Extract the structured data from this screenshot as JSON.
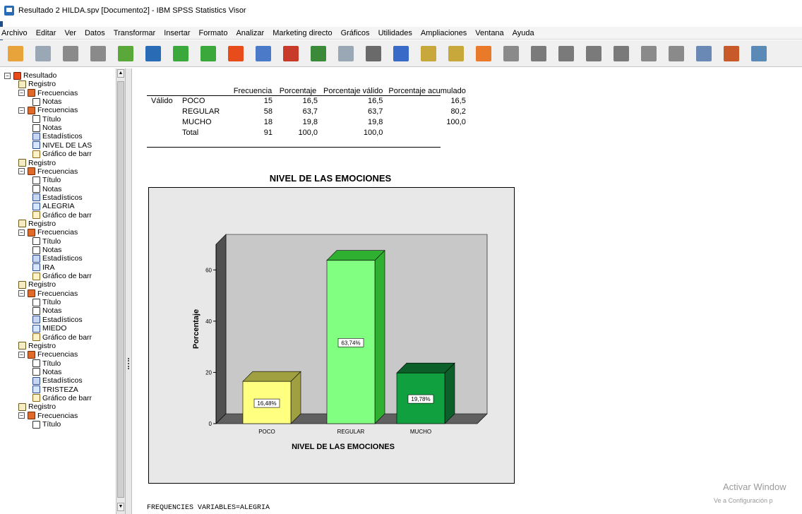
{
  "window": {
    "title": "Resultado 2 HILDA.spv [Documento2] - IBM SPSS Statistics Visor"
  },
  "menu": [
    "Archivo",
    "Editar",
    "Ver",
    "Datos",
    "Transformar",
    "Insertar",
    "Formato",
    "Analizar",
    "Marketing directo",
    "Gráficos",
    "Utilidades",
    "Ampliaciones",
    "Ventana",
    "Ayuda"
  ],
  "toolbar_icons": [
    {
      "name": "open-folder-icon",
      "color": "#e8a33a"
    },
    {
      "name": "save-icon",
      "color": "#9aa7b5"
    },
    {
      "name": "print-icon",
      "color": "#8a8a8a"
    },
    {
      "name": "print-preview-icon",
      "color": "#8a8a8a"
    },
    {
      "name": "export-icon",
      "color": "#5aa83a"
    },
    {
      "name": "recall-dialog-icon",
      "color": "#2a6bb5"
    },
    {
      "name": "undo-icon",
      "color": "#3aa83a"
    },
    {
      "name": "redo-icon",
      "color": "#3aa83a"
    },
    {
      "name": "goto-data-icon",
      "color": "#e84c1a"
    },
    {
      "name": "goto-case-icon",
      "color": "#4a7ac8"
    },
    {
      "name": "variables-icon",
      "color": "#c83a2a"
    },
    {
      "name": "use-sets-icon",
      "color": "#3a8a3a"
    },
    {
      "name": "show-all-icon",
      "color": "#9aa7b5"
    },
    {
      "name": "pie-icon",
      "color": "#6a6a6a"
    },
    {
      "name": "insert-output-icon",
      "color": "#3a6ac8"
    },
    {
      "name": "designate-window-icon",
      "color": "#c8a83a"
    },
    {
      "name": "edit-icon",
      "color": "#c8a83a"
    },
    {
      "name": "script-icon",
      "color": "#e87a2a"
    },
    {
      "name": "stop-icon",
      "color": "#8a8a8a"
    },
    {
      "name": "back-arrow-icon",
      "color": "#7a7a7a"
    },
    {
      "name": "forward-arrow-icon",
      "color": "#7a7a7a"
    },
    {
      "name": "expand-icon",
      "color": "#7a7a7a"
    },
    {
      "name": "collapse-icon",
      "color": "#7a7a7a"
    },
    {
      "name": "show-icon",
      "color": "#8a8a8a"
    },
    {
      "name": "hide-icon",
      "color": "#8a8a8a"
    },
    {
      "name": "insert-heading-icon",
      "color": "#6a8ab5"
    },
    {
      "name": "insert-title-icon",
      "color": "#c85a2a"
    },
    {
      "name": "insert-text-icon",
      "color": "#5a8ab5"
    }
  ],
  "outline": [
    {
      "level": 0,
      "type": "resultado",
      "label": "Resultado"
    },
    {
      "level": 1,
      "type": "registro",
      "label": "Registro"
    },
    {
      "level": 1,
      "type": "frec",
      "label": "Frecuencias"
    },
    {
      "level": 2,
      "type": "notas",
      "label": "Notas"
    },
    {
      "level": 1,
      "type": "frec",
      "label": "Frecuencias"
    },
    {
      "level": 2,
      "type": "titulo",
      "label": "Título"
    },
    {
      "level": 2,
      "type": "notas",
      "label": "Notas"
    },
    {
      "level": 2,
      "type": "estad",
      "label": "Estadísticos"
    },
    {
      "level": 2,
      "type": "tabla",
      "label": "NIVEL DE LAS"
    },
    {
      "level": 2,
      "type": "grafico",
      "label": "Gráfico de barr"
    },
    {
      "level": 1,
      "type": "registro",
      "label": "Registro"
    },
    {
      "level": 1,
      "type": "frec",
      "label": "Frecuencias"
    },
    {
      "level": 2,
      "type": "titulo",
      "label": "Título"
    },
    {
      "level": 2,
      "type": "notas",
      "label": "Notas"
    },
    {
      "level": 2,
      "type": "estad",
      "label": "Estadísticos"
    },
    {
      "level": 2,
      "type": "tabla",
      "label": "ALEGRIA"
    },
    {
      "level": 2,
      "type": "grafico",
      "label": "Gráfico de barr"
    },
    {
      "level": 1,
      "type": "registro",
      "label": "Registro"
    },
    {
      "level": 1,
      "type": "frec",
      "label": "Frecuencias"
    },
    {
      "level": 2,
      "type": "titulo",
      "label": "Título"
    },
    {
      "level": 2,
      "type": "notas",
      "label": "Notas"
    },
    {
      "level": 2,
      "type": "estad",
      "label": "Estadísticos"
    },
    {
      "level": 2,
      "type": "tabla",
      "label": "IRA"
    },
    {
      "level": 2,
      "type": "grafico",
      "label": "Gráfico de barr"
    },
    {
      "level": 1,
      "type": "registro",
      "label": "Registro"
    },
    {
      "level": 1,
      "type": "frec",
      "label": "Frecuencias"
    },
    {
      "level": 2,
      "type": "titulo",
      "label": "Título"
    },
    {
      "level": 2,
      "type": "notas",
      "label": "Notas"
    },
    {
      "level": 2,
      "type": "estad",
      "label": "Estadísticos"
    },
    {
      "level": 2,
      "type": "tabla",
      "label": "MIEDO"
    },
    {
      "level": 2,
      "type": "grafico",
      "label": "Gráfico de barr"
    },
    {
      "level": 1,
      "type": "registro",
      "label": "Registro"
    },
    {
      "level": 1,
      "type": "frec",
      "label": "Frecuencias"
    },
    {
      "level": 2,
      "type": "titulo",
      "label": "Título"
    },
    {
      "level": 2,
      "type": "notas",
      "label": "Notas"
    },
    {
      "level": 2,
      "type": "estad",
      "label": "Estadísticos"
    },
    {
      "level": 2,
      "type": "tabla",
      "label": "TRISTEZA"
    },
    {
      "level": 2,
      "type": "grafico",
      "label": "Gráfico de barr"
    },
    {
      "level": 1,
      "type": "registro",
      "label": "Registro"
    },
    {
      "level": 1,
      "type": "frec",
      "label": "Frecuencias"
    },
    {
      "level": 2,
      "type": "titulo",
      "label": "Título"
    }
  ],
  "freq_table": {
    "headers": [
      "Frecuencia",
      "Porcentaje",
      "Porcentaje válido",
      "Porcentaje acumulado"
    ],
    "group_label": "Válido",
    "rows": [
      {
        "label": "POCO",
        "frecuencia": "15",
        "porcentaje": "16,5",
        "valido": "16,5",
        "acumulado": "16,5"
      },
      {
        "label": "REGULAR",
        "frecuencia": "58",
        "porcentaje": "63,7",
        "valido": "63,7",
        "acumulado": "80,2"
      },
      {
        "label": "MUCHO",
        "frecuencia": "18",
        "porcentaje": "19,8",
        "valido": "19,8",
        "acumulado": "100,0"
      },
      {
        "label": "Total",
        "frecuencia": "91",
        "porcentaje": "100,0",
        "valido": "100,0",
        "acumulado": ""
      }
    ]
  },
  "chart_heading": "NIVEL DE LAS EMOCIONES",
  "chart_data": {
    "type": "bar",
    "title": "NIVEL DE LAS EMOCIONES",
    "xlabel": "NIVEL DE LAS EMOCIONES",
    "ylabel": "Porcentaje",
    "categories": [
      "POCO",
      "REGULAR",
      "MUCHO"
    ],
    "values": [
      16.48,
      63.74,
      19.78
    ],
    "data_labels": [
      "16,48%",
      "63,74%",
      "19,78%"
    ],
    "y_ticks": [
      0,
      20,
      40,
      60
    ],
    "ylim": [
      0,
      70
    ],
    "colors": [
      "#ffff80",
      "#80ff80",
      "#10a040"
    ],
    "side_colors": [
      "#a0a040",
      "#30b030",
      "#0a6028"
    ],
    "background": "#c8c8c8",
    "grid": false
  },
  "syntax_line": "FREQUENCIES VARIABLES=ALEGRIA",
  "watermark": {
    "line1": "Activar Window",
    "line2": "Ve a Configuración p"
  }
}
